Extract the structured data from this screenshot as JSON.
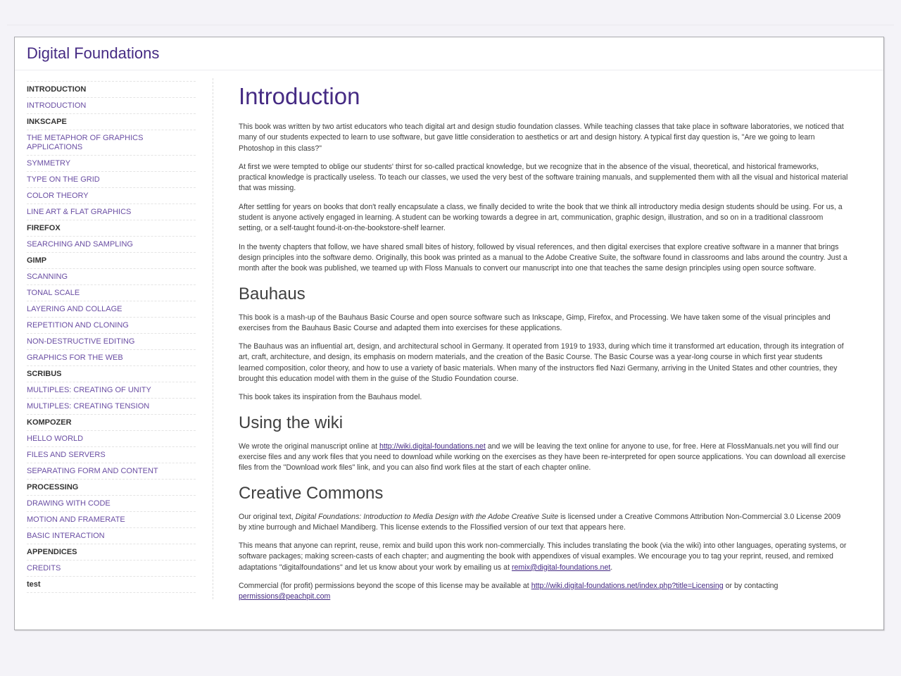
{
  "site": {
    "title": "Digital Foundations"
  },
  "sidebar": {
    "items": [
      {
        "label": "INTRODUCTION",
        "type": "heading"
      },
      {
        "label": "INTRODUCTION",
        "type": "link"
      },
      {
        "label": "INKSCAPE",
        "type": "heading"
      },
      {
        "label": "THE METAPHOR OF GRAPHICS APPLICATIONS",
        "type": "link"
      },
      {
        "label": "SYMMETRY",
        "type": "link"
      },
      {
        "label": "TYPE ON THE GRID",
        "type": "link"
      },
      {
        "label": "COLOR THEORY",
        "type": "link"
      },
      {
        "label": "LINE ART & FLAT GRAPHICS",
        "type": "link"
      },
      {
        "label": "FIREFOX",
        "type": "heading"
      },
      {
        "label": "SEARCHING AND SAMPLING",
        "type": "link"
      },
      {
        "label": "GIMP",
        "type": "heading"
      },
      {
        "label": "SCANNING",
        "type": "link"
      },
      {
        "label": "TONAL SCALE",
        "type": "link"
      },
      {
        "label": "LAYERING AND COLLAGE",
        "type": "link"
      },
      {
        "label": "REPETITION AND CLONING",
        "type": "link"
      },
      {
        "label": "NON-DESTRUCTIVE EDITING",
        "type": "link"
      },
      {
        "label": "GRAPHICS FOR THE WEB",
        "type": "link"
      },
      {
        "label": "SCRIBUS",
        "type": "heading"
      },
      {
        "label": "MULTIPLES: CREATING OF UNITY",
        "type": "link"
      },
      {
        "label": "MULTIPLES: CREATING TENSION",
        "type": "link"
      },
      {
        "label": "KOMPOZER",
        "type": "heading"
      },
      {
        "label": "HELLO WORLD",
        "type": "link"
      },
      {
        "label": "FILES AND SERVERS",
        "type": "link"
      },
      {
        "label": "SEPARATING FORM AND CONTENT",
        "type": "link"
      },
      {
        "label": "PROCESSING",
        "type": "heading"
      },
      {
        "label": "DRAWING WITH CODE",
        "type": "link"
      },
      {
        "label": "MOTION AND FRAMERATE",
        "type": "link"
      },
      {
        "label": "BASIC INTERACTION",
        "type": "link"
      },
      {
        "label": "APPENDICES",
        "type": "heading"
      },
      {
        "label": "CREDITS",
        "type": "link"
      },
      {
        "label": "test",
        "type": "heading"
      }
    ]
  },
  "content": {
    "title": "Introduction",
    "intro": {
      "p1": "This book was written by two artist educators who teach digital art and design studio foundation classes. While teaching classes that take place in software laboratories, we noticed that many of our students expected to learn to use software, but gave little consideration to aesthetics or art and design history. A typical first day question is, \"Are we going to learn Photoshop in this class?\"",
      "p2": "At first we were tempted to oblige our students' thirst for so-called practical knowledge, but we recognize that in the absence of the visual, theoretical, and historical frameworks, practical knowledge is practically useless. To teach our classes, we used the very best of the software training manuals, and supplemented them with all the visual and historical material that was missing.",
      "p3": "After settling for years on books that don't really encapsulate a class, we finally decided to write the book that we think all introductory media design students should be using. For us, a student is anyone actively engaged in learning. A student can be working towards a degree in art, communication, graphic design, illustration, and so on in a traditional classroom setting, or a self-taught found-it-on-the-bookstore-shelf learner.",
      "p4": "In the twenty chapters that follow, we have shared small bites of history, followed by visual references, and then digital exercises that explore creative software in a manner that brings design principles into the software demo. Originally, this book was printed as a manual to the Adobe Creative Suite, the software found in classrooms and labs around the country. Just a month after the book was published, we teamed up with Floss Manuals to convert our manuscript into one that teaches the same design principles using open source software."
    },
    "bauhaus": {
      "heading": "Bauhaus",
      "p1": "This book is a mash-up of the Bauhaus Basic Course and open source software such as Inkscape, Gimp, Firefox, and Processing. We have taken some of the visual principles and exercises from the Bauhaus Basic Course and adapted them into exercises for these applications.",
      "p2": "The Bauhaus was an influential art, design, and architectural school in Germany. It operated from 1919 to 1933, during which time it transformed art education, through its integration of art, craft, architecture, and design, its emphasis on modern materials, and the creation of the Basic Course. The Basic Course was a year-long course in which first year students learned composition, color theory, and how to use a variety of basic materials. When many of the instructors fled Nazi Germany, arriving in the United States and other countries, they brought this education model with them in the guise of the Studio Foundation course.",
      "p3": "This book takes its inspiration from the Bauhaus model."
    },
    "wiki": {
      "heading": "Using the wiki",
      "p1_before": "We wrote the original manuscript online at ",
      "p1_link": "http://wiki.digital-foundations.net",
      "p1_after": " and we will be leaving the text online for anyone to use, for free. Here at FlossManuals.net you will find our exercise files and any work files that you need to download while working on the exercises as they have been re-interpreted for open source applications. You can download all exercise files from the \"Download work files\" link, and you can also find work files at the start of each chapter online."
    },
    "cc": {
      "heading": "Creative Commons",
      "p1_before": "Our original text, ",
      "p1_italic": "Digital Foundations: Introduction to Media Design with the Adobe Creative Suite",
      "p1_after": " is licensed under a Creative Commons Attribution Non-Commercial 3.0 License 2009 by xtine burrough and Michael Mandiberg. This license extends to the Flossified version of our text that appears here.",
      "p2_before": "This means that anyone can reprint, reuse, remix and build upon this work non-commercially. This includes translating the book (via the wiki) into other languages, operating systems, or software packages; making screen-casts of each chapter; and augmenting the book with appendixes of visual examples. We encourage you to tag your reprint, reused, and remixed adaptations \"digitalfoundations\" and let us know about your work by emailing us at ",
      "p2_link": "remix@digital-foundations.net",
      "p2_after": ".",
      "p3_before": "Commercial (for profit) permissions beyond the scope of this license may be available at ",
      "p3_link": "http://wiki.digital-foundations.net/index.php?title=Licensing",
      "p3_middle": " or by contacting ",
      "p3_link2": "permissions@peachpit.com"
    }
  }
}
